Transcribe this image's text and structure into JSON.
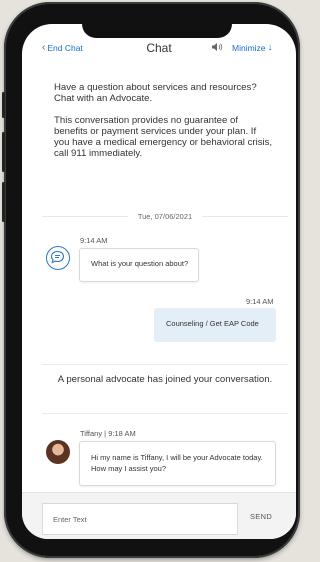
{
  "header": {
    "end_chat": "End Chat",
    "title": "Chat",
    "minimize": "Minimize"
  },
  "intro": {
    "line1": "Have a question about services and resources? Chat with an Advocate.",
    "line2": "This conversation provides no guarantee of benefits or payment services under your plan. If you have a medical emergency or behavioral crisis, call 911 immediately."
  },
  "date_divider": "Tue, 07/06/2021",
  "messages": [
    {
      "time": "9:14 AM",
      "text": "What is your question about?"
    },
    {
      "time": "9:14 AM",
      "text": "Counseling / Get EAP Code"
    }
  ],
  "system_note": "A personal advocate has joined your conversation.",
  "agent_message": {
    "meta": "Tiffany | 9:18 AM",
    "text": "Hi my name is Tiffany, I will be your Advocate today. How may I assist you?"
  },
  "composer": {
    "placeholder": "Enter Text",
    "send": "SEND"
  },
  "colors": {
    "accent": "#1a6fc8",
    "outgoing_bubble": "#e4eef6"
  }
}
